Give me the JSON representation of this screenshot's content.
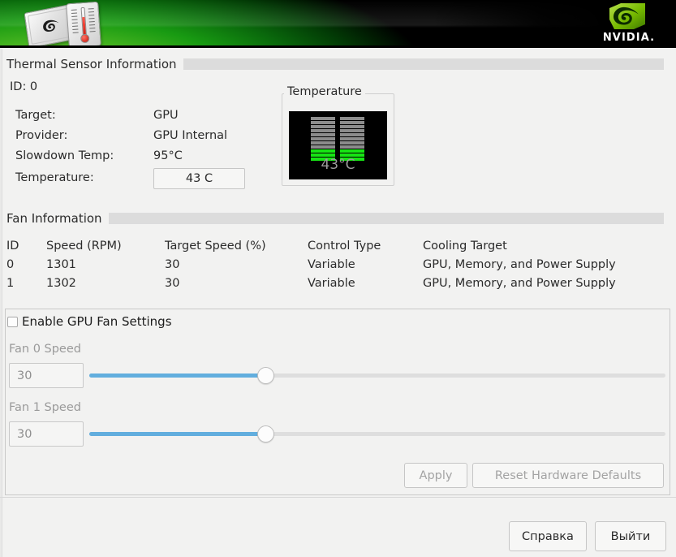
{
  "window": {
    "header_icon": "gpu-card-thermometer-icon",
    "brand": "NVIDIA."
  },
  "thermal": {
    "section_title": "Thermal Sensor Information",
    "id_label": "ID: 0",
    "rows": [
      {
        "label": "Target:",
        "value": "GPU"
      },
      {
        "label": "Provider:",
        "value": "GPU Internal"
      },
      {
        "label": "Slowdown Temp:",
        "value": "95°C"
      }
    ],
    "temperature_label": "Temperature:",
    "temperature_value": "43 C",
    "gauge": {
      "legend": "Temperature",
      "readout": "43°C",
      "total_rows": 11,
      "active_rows": 3,
      "active_color": "#17e614",
      "inactive_color": "#8c8c8c",
      "background": "#000000"
    }
  },
  "fan_info": {
    "section_title": "Fan Information",
    "columns": [
      "ID",
      "Speed (RPM)",
      "Target Speed (%)",
      "Control Type",
      "Cooling Target"
    ],
    "rows": [
      {
        "id": "0",
        "speed": "1301",
        "target": "30",
        "control": "Variable",
        "cooling": "GPU, Memory, and Power Supply"
      },
      {
        "id": "1",
        "speed": "1302",
        "target": "30",
        "control": "Variable",
        "cooling": "GPU, Memory, and Power Supply"
      }
    ]
  },
  "fan_settings": {
    "enable_checkbox_label": "Enable GPU Fan Settings",
    "enable_checked": false,
    "sliders": [
      {
        "label": "Fan 0 Speed",
        "value": "30",
        "percent": 30
      },
      {
        "label": "Fan 1 Speed",
        "value": "30",
        "percent": 30
      }
    ],
    "apply_label": "Apply",
    "reset_label": "Reset Hardware Defaults",
    "apply_enabled": false,
    "reset_enabled": false
  },
  "footer": {
    "help_label": "Справка",
    "quit_label": "Выйти"
  },
  "colors": {
    "accent_green": "#76b900",
    "slider_blue": "#62aede",
    "gauge_green": "#17e614"
  }
}
